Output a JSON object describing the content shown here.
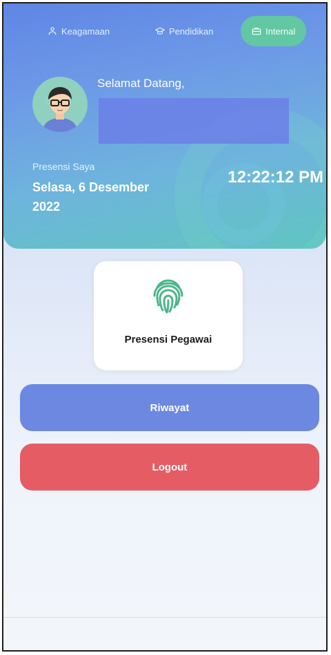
{
  "nav": {
    "items": [
      {
        "label": "Keagamaan",
        "icon": "users-icon"
      },
      {
        "label": "Pendidikan",
        "icon": "graduation-cap-icon"
      },
      {
        "label": "Internal",
        "icon": "briefcase-icon",
        "active": true
      }
    ]
  },
  "header": {
    "welcome": "Selamat Datang,"
  },
  "presence": {
    "label": "Presensi Saya",
    "date": "Selasa, 6 Desember 2022",
    "time": "12:22:12 PM"
  },
  "card": {
    "label": "Presensi Pegawai",
    "icon": "fingerprint-icon"
  },
  "buttons": {
    "history_label": "Riwayat",
    "logout_label": "Logout"
  },
  "colors": {
    "header_blue": "#5f86e4",
    "active_tab": "#62c7a3",
    "history_button": "#6d88e1",
    "logout_button": "#e65c65",
    "fingerprint": "#4bb58a"
  }
}
